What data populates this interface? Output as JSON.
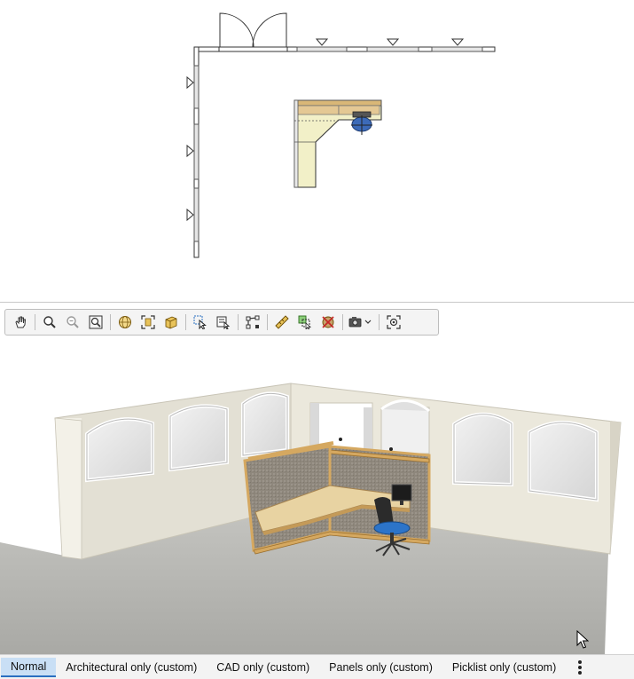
{
  "plan_view": {
    "label": "floor-plan"
  },
  "toolbar": {
    "tools": [
      {
        "name": "pan-icon"
      },
      {
        "name": "zoom-icon"
      },
      {
        "name": "zoom-out-icon"
      },
      {
        "name": "zoom-extents-icon"
      },
      {
        "name": "globe-view-icon"
      },
      {
        "name": "zoom-selection-icon"
      },
      {
        "name": "3d-box-icon"
      },
      {
        "name": "select-arrow-icon"
      },
      {
        "name": "select-list-icon"
      },
      {
        "name": "connect-points-icon"
      },
      {
        "name": "ruler-icon"
      },
      {
        "name": "copy-select-icon"
      },
      {
        "name": "delete-icon"
      },
      {
        "name": "camera-icon"
      },
      {
        "name": "target-icon"
      }
    ]
  },
  "tabs": {
    "items": [
      {
        "label": "Normal",
        "active": true
      },
      {
        "label": "Architectural only (custom)",
        "active": false
      },
      {
        "label": "CAD only (custom)",
        "active": false
      },
      {
        "label": "Panels only (custom)",
        "active": false
      },
      {
        "label": "Picklist only (custom)",
        "active": false
      }
    ]
  },
  "colors": {
    "accent": "#2a6fc0",
    "wall": "#ece9df",
    "floor": "#b6b6b2",
    "panel_fabric": "#8e877c",
    "panel_frame": "#d5a860",
    "work_surface": "#e8d3a2",
    "chair": "#2c74c9"
  }
}
